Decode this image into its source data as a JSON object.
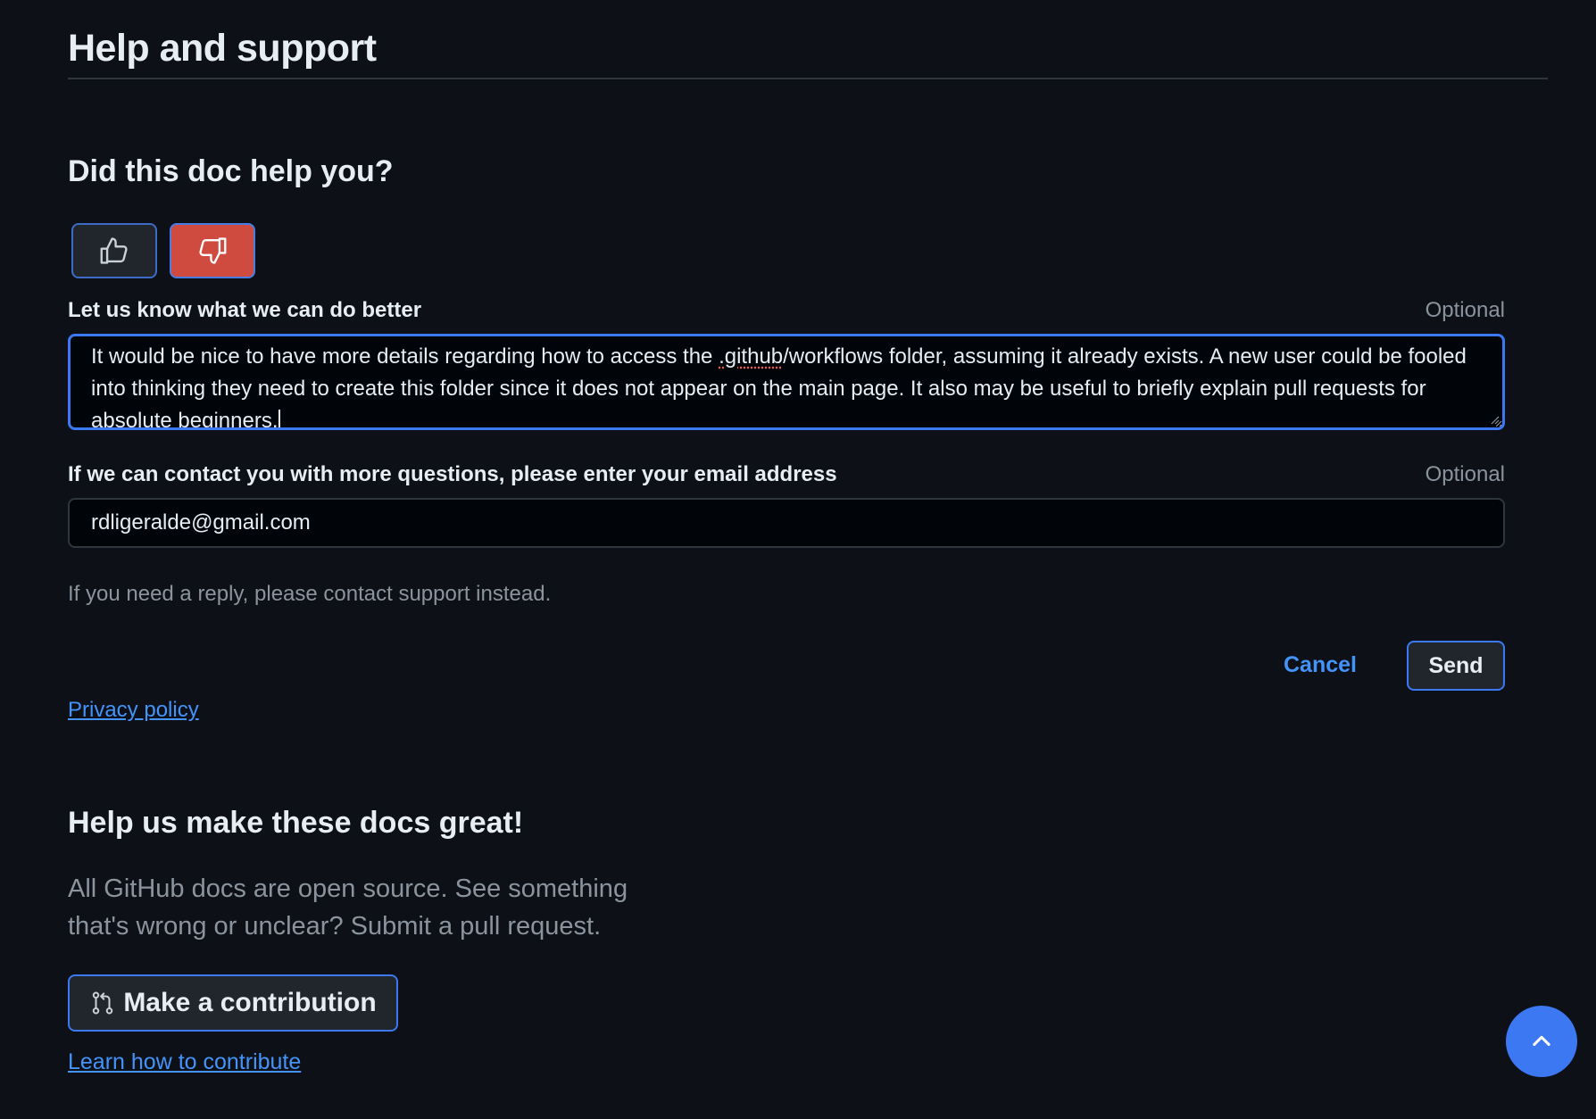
{
  "header": {
    "title": "Help and support"
  },
  "feedback": {
    "question": "Did this doc help you?",
    "thumbs_up_icon": "thumbs-up-icon",
    "thumbs_down_icon": "thumbs-down-icon",
    "selected_vote": "thumbs-down",
    "comment_label": "Let us know what we can do better",
    "comment_optional": "Optional",
    "comment_value_part1": "It would be nice to have more details regarding how to access the ",
    "comment_value_spell": ".github",
    "comment_value_part2": "/workflows folder, assuming it already exists. A new user could be fooled into thinking they need to create this folder since it does not appear on the main page. It also may be useful to briefly explain pull requests for absolute beginners.",
    "email_label": "If we can contact you with more questions, please enter your email address",
    "email_optional": "Optional",
    "email_value": "rdligeralde@gmail.com",
    "help_note": "If you need a reply, please contact support instead.",
    "cancel_label": "Cancel",
    "send_label": "Send",
    "privacy_link": "Privacy policy"
  },
  "contribute": {
    "title": "Help us make these docs great!",
    "description": "All GitHub docs are open source. See something that's wrong or unclear? Submit a pull request.",
    "button_label": "Make a contribution",
    "button_icon": "git-pull-request-icon",
    "learn_link": "Learn how to contribute"
  },
  "scroll_top": {
    "icon": "chevron-up-icon"
  },
  "colors": {
    "background": "#0d1117",
    "accent": "#3b78f2",
    "link": "#4493f8",
    "thumbs_down_selected": "#cf4a3f",
    "muted_text": "#8b949e"
  }
}
